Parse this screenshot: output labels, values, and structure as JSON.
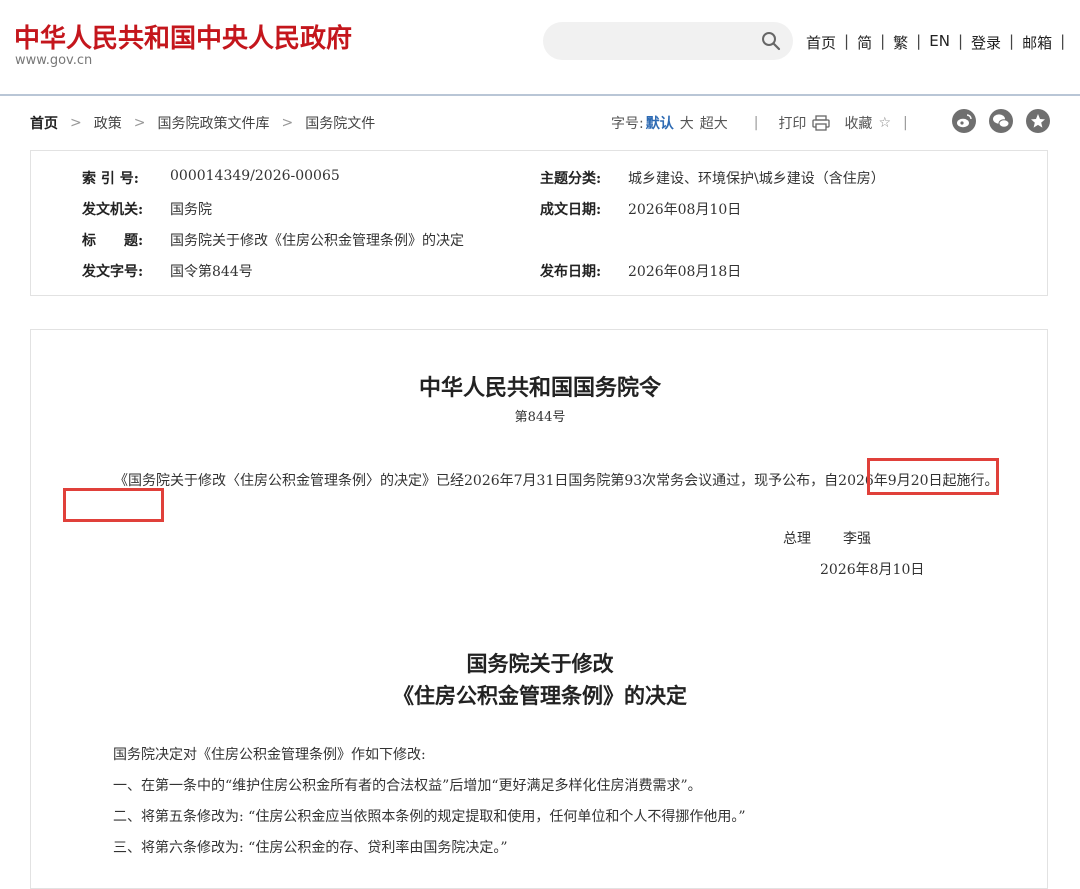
{
  "header": {
    "site_title": "中华人民共和国中央人民政府",
    "site_url": "www.gov.cn",
    "search_placeholder": "",
    "links": [
      "首页",
      "简",
      "繁",
      "EN",
      "登录",
      "邮箱"
    ],
    "link_separator": "|"
  },
  "breadcrumb": {
    "items": [
      "首页",
      "政策",
      "国务院政策文件库",
      "国务院文件"
    ],
    "arrow": ">"
  },
  "tools": {
    "font_label": "字号:",
    "font_default": "默认",
    "font_large": "大",
    "font_xlarge": "超大",
    "print_label": "打印",
    "favorite_label": "收藏",
    "separator": "|",
    "share_icons": [
      "weibo-icon",
      "wechat-icon",
      "star-share-icon"
    ]
  },
  "info": {
    "index_label": "索 引 号:",
    "index_value": "000014349/2026-00065",
    "topic_label": "主题分类:",
    "topic_value": "城乡建设、环境保护\\城乡建设（含住房）",
    "issuer_label": "发文机关:",
    "issuer_value": "国务院",
    "written_label": "成文日期:",
    "written_value": "2026年08月10日",
    "title_label": "标　　题:",
    "title_value": "国务院关于修改《住房公积金管理条例》的决定",
    "docno_label": "发文字号:",
    "docno_value": "国令第844号",
    "publish_label": "发布日期:",
    "publish_value": "2026年08月18日"
  },
  "document": {
    "order_title": "中华人民共和国国务院令",
    "order_number": "第844号",
    "paragraph_part1": "《国务院关于修改〈住房公积金管理条例〉的决定》已经2026年7月31日国务院第93次常务会议通过，现予公布，",
    "paragraph_highlight1": "自2026年9月20日",
    "paragraph_highlight2": "起施行。",
    "sign_role": "总理",
    "sign_name": "李强",
    "sign_date": "2026年8月10日",
    "decision_title_line1": "国务院关于修改",
    "decision_title_line2": "《住房公积金管理条例》的决定",
    "body_lines": [
      "国务院决定对《住房公积金管理条例》作如下修改:",
      "一、在第一条中的“维护住房公积金所有者的合法权益”后增加“更好满足多样化住房消费需求”。",
      "二、将第五条修改为: “住房公积金应当依照本条例的规定提取和使用，任何单位和个人不得挪作他用。”",
      "三、将第六条修改为: “住房公积金的存、贷利率由国务院决定。”"
    ]
  },
  "colors": {
    "brand_red": "#c4161c",
    "highlight_box": "#e0403a",
    "link_blue": "#2d6ab3"
  }
}
